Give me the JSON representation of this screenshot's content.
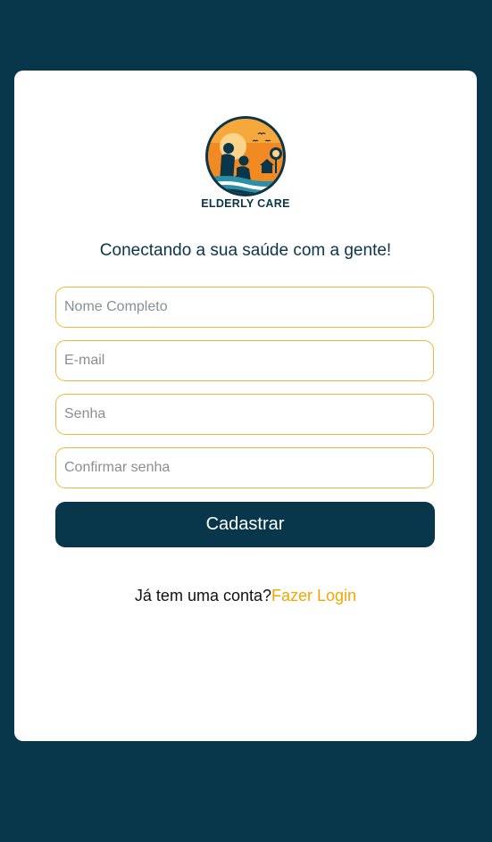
{
  "app": {
    "brand_name": "ELDERLY CARE",
    "tagline": "Conectando a sua saúde com a gente!"
  },
  "form": {
    "full_name": {
      "placeholder": "Nome Completo",
      "value": ""
    },
    "email": {
      "placeholder": "E-mail",
      "value": ""
    },
    "password": {
      "placeholder": "Senha",
      "value": ""
    },
    "confirm_password": {
      "placeholder": "Confirmar senha",
      "value": ""
    },
    "submit_label": "Cadastrar"
  },
  "footer": {
    "prompt": "Já tem uma conta?",
    "login_link": "Fazer Login"
  },
  "colors": {
    "background": "#08374c",
    "card": "#ffffff",
    "accent_orange": "#f5a400",
    "field_border": "#f4b63a",
    "text_dark": "#0b3548"
  },
  "icons": {
    "logo": "elderly-care-logo-icon"
  }
}
